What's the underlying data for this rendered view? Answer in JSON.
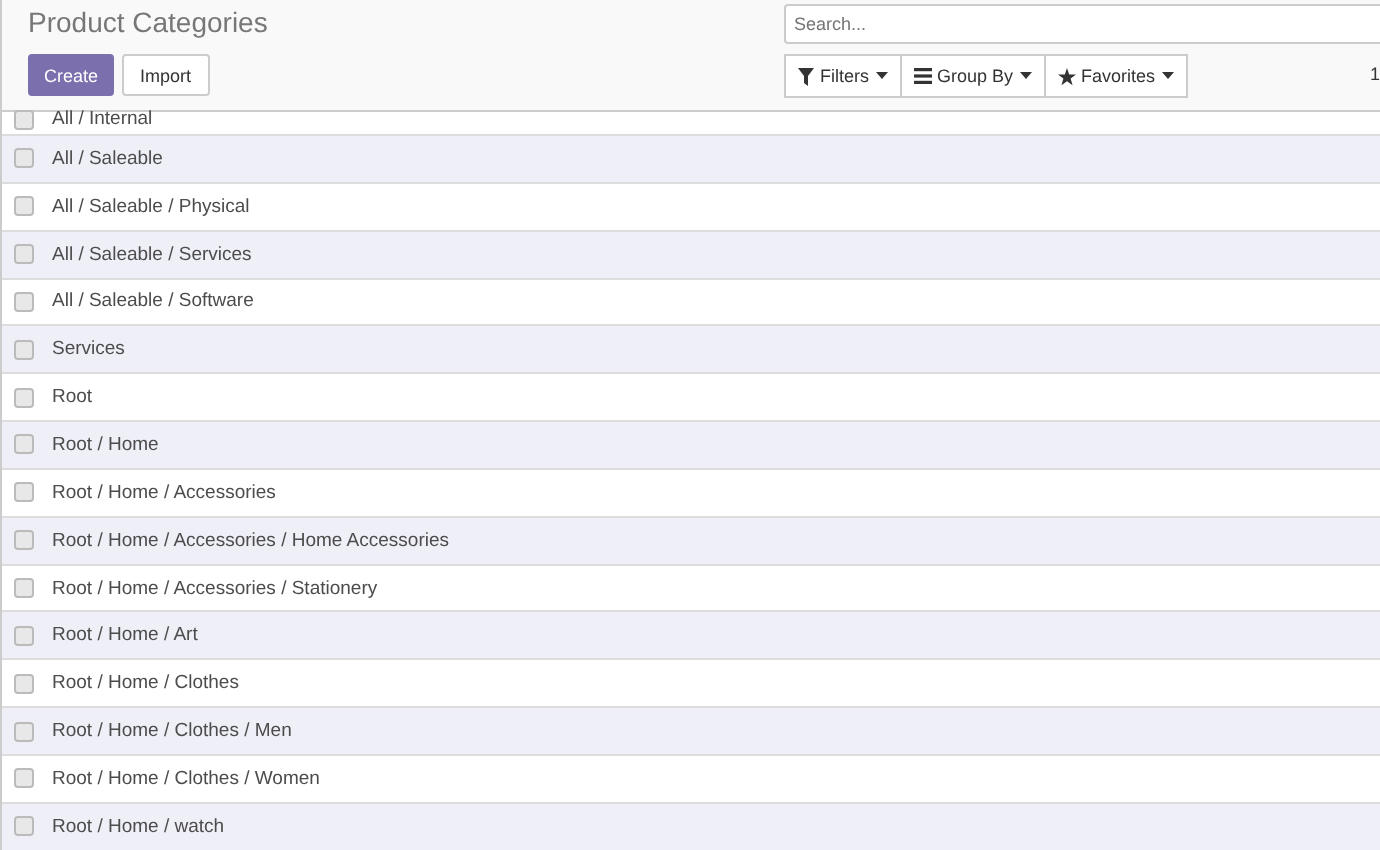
{
  "title": "Product Categories",
  "buttons": {
    "create": "Create",
    "import": "Import"
  },
  "search": {
    "placeholder": "Search..."
  },
  "filters": [
    {
      "kind": "filter",
      "label": "Filters"
    },
    {
      "kind": "group",
      "label": "Group By"
    },
    {
      "kind": "star",
      "label": "Favorites"
    }
  ],
  "pager": "1",
  "rows": [
    {
      "name": "All / Internal",
      "checked": false
    },
    {
      "name": "All / Saleable",
      "checked": false
    },
    {
      "name": "All / Saleable / Physical",
      "checked": false
    },
    {
      "name": "All / Saleable / Services",
      "checked": false
    },
    {
      "name": "All / Saleable / Software",
      "checked": false
    },
    {
      "name": "Services",
      "checked": false
    },
    {
      "name": "Root",
      "checked": false
    },
    {
      "name": "Root / Home",
      "checked": false
    },
    {
      "name": "Root / Home / Accessories",
      "checked": false
    },
    {
      "name": "Root / Home / Accessories / Home Accessories",
      "checked": false
    },
    {
      "name": "Root / Home / Accessories / Stationery",
      "checked": false
    },
    {
      "name": "Root / Home / Art",
      "checked": false
    },
    {
      "name": "Root / Home / Clothes",
      "checked": false
    },
    {
      "name": "Root / Home / Clothes / Men",
      "checked": false
    },
    {
      "name": "Root / Home / Clothes / Women",
      "checked": false
    },
    {
      "name": "Root / Home / watch",
      "checked": false
    }
  ]
}
